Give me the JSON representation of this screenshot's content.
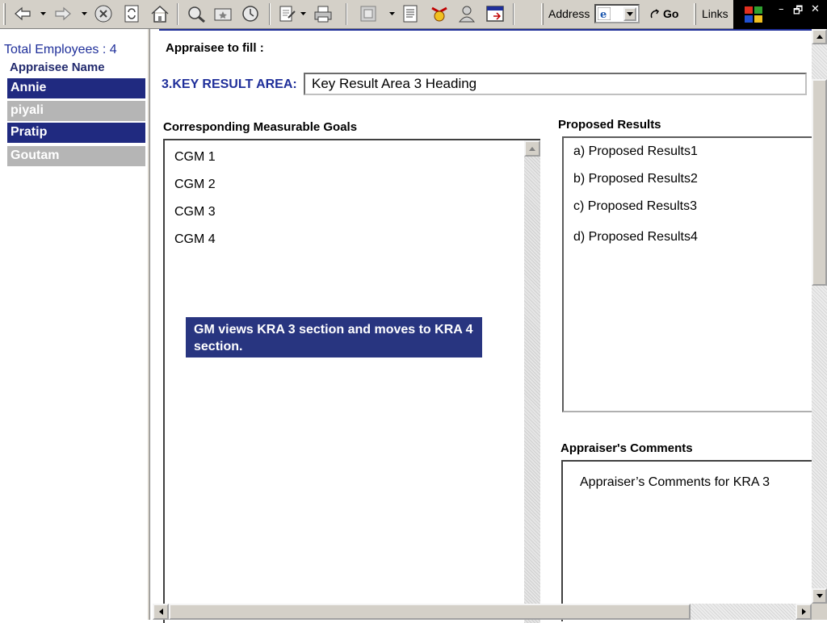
{
  "toolbar": {
    "icons": [
      "back-icon",
      "forward-icon",
      "stop-icon",
      "refresh-icon",
      "home-icon",
      "search-icon",
      "favorites-icon",
      "history-icon",
      "edit-icon",
      "print-icon",
      "fullscreen-icon",
      "discuss-icon",
      "messenger-icon",
      "contacts-icon",
      "window-icon"
    ],
    "address_label": "Address",
    "go_label": "Go",
    "links_label": "Links",
    "window_controls": [
      "–",
      "🗗",
      "✕"
    ]
  },
  "sidebar": {
    "total_employees": "Total Employees : 4",
    "heading": "Appraisee Name",
    "employees": [
      {
        "name": "Annie",
        "state": "active"
      },
      {
        "name": "piyali",
        "state": "inactive"
      },
      {
        "name": "Pratip",
        "state": "active"
      },
      {
        "name": "Goutam",
        "state": "inactive"
      }
    ]
  },
  "main": {
    "appraisee_fill": "Appraisee to fill :",
    "kra_label": "3.KEY RESULT AREA:",
    "kra_value": "Key Result Area 3 Heading",
    "cmg_heading": "Corresponding Measurable Goals",
    "cmg_items": [
      "CGM 1",
      "CGM 2",
      "CGM 3",
      "CGM 4"
    ],
    "proposed_heading": "Proposed Results",
    "proposed_items": [
      "a) Proposed Results1",
      "b) Proposed Results2",
      "c) Proposed Results3",
      "d) Proposed Results4"
    ],
    "comments_heading": "Appraiser's Comments",
    "comments_text": "Appraiser’s Comments for KRA 3",
    "note": "GM views KRA 3 section and moves to KRA 4 section."
  },
  "colors": {
    "accent": "#1f2f9a",
    "active_row": "#202a80",
    "inactive_row": "#b5b5b5",
    "note_bg": "#283580"
  }
}
